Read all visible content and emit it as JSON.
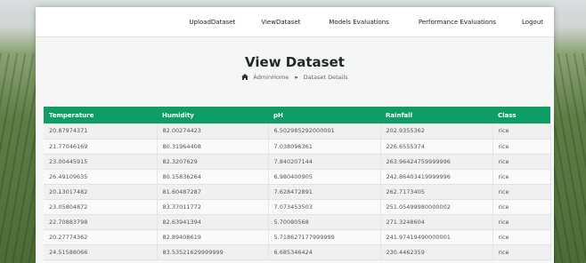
{
  "nav": {
    "items": [
      "UploadDataset",
      "ViewDataset",
      "Models Evaluations",
      "Performance Evaluations",
      "Logout"
    ]
  },
  "page": {
    "title": "View Dataset",
    "breadcrumb": {
      "home": "AdminHome",
      "separator": "»",
      "current": "Dataset Details"
    }
  },
  "table": {
    "headers": [
      "Temperature",
      "Humidity",
      "pH",
      "Rainfall",
      "Class"
    ],
    "rows": [
      [
        "20.87974371",
        "82.00274423",
        "6.502985292000001",
        "202.9355362",
        "rice"
      ],
      [
        "21.77046169",
        "80.31964408",
        "7.038096361",
        "226.6555374",
        "rice"
      ],
      [
        "23.00445915",
        "82.3207629",
        "7.840207144",
        "263.96424759999996",
        "rice"
      ],
      [
        "26.49109635",
        "80.15836264",
        "6.980400905",
        "242.86403419999996",
        "rice"
      ],
      [
        "20.13017482",
        "81.60487287",
        "7.628472891",
        "262.7173405",
        "rice"
      ],
      [
        "23.05804872",
        "83.37011772",
        "7.073453503",
        "251.05499980000002",
        "rice"
      ],
      [
        "22.70883798",
        "82.63941394",
        "5.70080568",
        "271.3248604",
        "rice"
      ],
      [
        "20.27774362",
        "82.89408619",
        "5.718627177999999",
        "241.97419490000001",
        "rice"
      ],
      [
        "24.51588066",
        "83.53521629999999",
        "6.685346424",
        "230.4462359",
        "rice"
      ]
    ]
  },
  "colors": {
    "header_green": "#0f9d67"
  }
}
